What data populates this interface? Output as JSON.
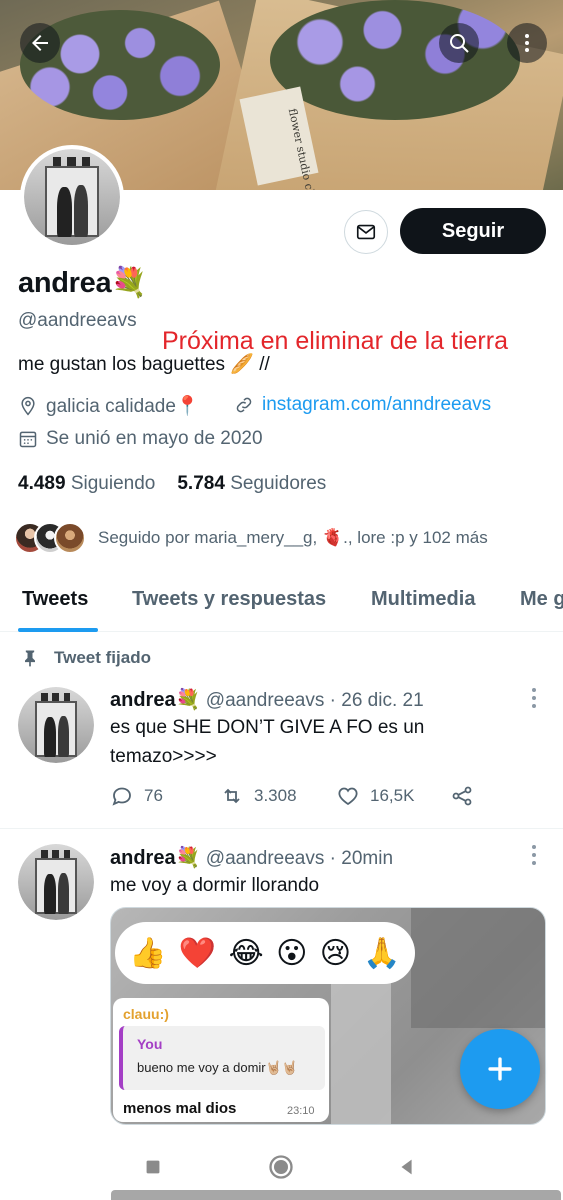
{
  "banner": {
    "tag_text": "flower studio chacha"
  },
  "header": {
    "back_icon": "arrow-left-icon",
    "search_icon": "search-icon",
    "more_icon": "more-vertical-icon"
  },
  "profile": {
    "name": "andrea💐",
    "handle": "@aandreeavs",
    "overlay_text": "Próxima en eliminar de la tierra",
    "bio": "me gustan los baguettes 🥖 //",
    "location": "galicia calidade📍",
    "website": "instagram.com/anndreeavs",
    "joined": "Se unió en mayo de 2020",
    "following_count": "4.489",
    "following_label": "Siguiendo",
    "followers_count": "5.784",
    "followers_label": "Seguidores",
    "followed_by": "Seguido por maria_mery__g, 🫀., lore :p y 102 más",
    "follow_button": "Seguir",
    "message_icon": "mail-icon"
  },
  "tabs": [
    "Tweets",
    "Tweets y respuestas",
    "Multimedia",
    "Me g"
  ],
  "pinned_label": "Tweet fijado",
  "tweets": [
    {
      "name": "andrea💐",
      "handle": "@aandreeavs",
      "sep": "·",
      "time": "26 dic. 21",
      "text_line1": "es que SHE DON’T GIVE A FO es un",
      "text_line2": "temazo>>>>",
      "replies": "76",
      "retweets": "3.308",
      "likes": "16,5K"
    },
    {
      "name": "andrea💐",
      "handle": "@aandreeavs",
      "sep": "·",
      "time": "20min",
      "text_line1": "me voy a dormir llorando",
      "media": {
        "reactions": [
          "👍",
          "❤️",
          "😂",
          "😮",
          "😢",
          "🙏"
        ],
        "chat_name": "clauu:)",
        "quote_name": "You",
        "quote_text": "bueno me voy a domir🤘🏼🤘🏼",
        "message": "menos mal dios",
        "time": "23:10"
      }
    }
  ],
  "colors": {
    "accent": "#1d9bf0",
    "overlay_red": "#e3262b",
    "text_primary": "#0f1419",
    "text_secondary": "#536471"
  }
}
